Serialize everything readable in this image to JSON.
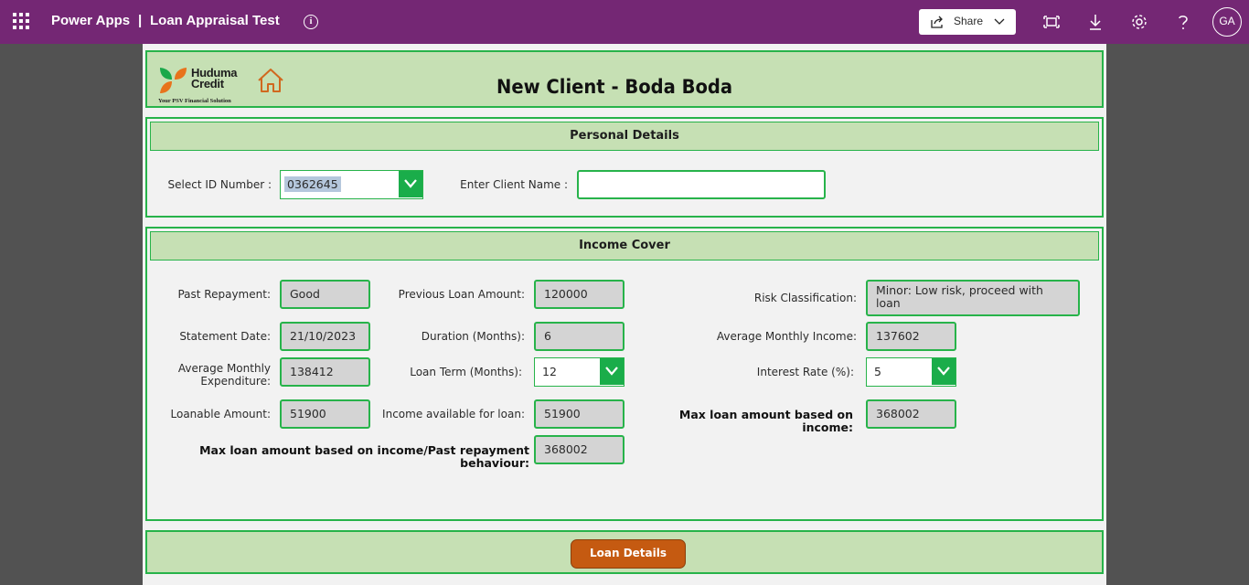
{
  "topbar": {
    "app_name": "Power Apps",
    "separator": "|",
    "app_title": "Loan Appraisal Test",
    "share_label": "Share",
    "avatar_initials": "GA",
    "icons": [
      "waffle-icon",
      "info-icon",
      "share-icon",
      "chevron-down-icon",
      "fit-screen-icon",
      "download-icon",
      "settings-icon",
      "help-icon"
    ]
  },
  "header": {
    "logo_line1": "Huduma",
    "logo_line2": "Credit",
    "logo_tagline": "Your PSV Financial Solution",
    "title": "New Client - Boda Boda"
  },
  "personal": {
    "section_title": "Personal Details",
    "id_label": "Select ID Number :",
    "id_value": "0362645",
    "name_label": "Enter Client Name :",
    "name_value": ""
  },
  "income": {
    "section_title": "Income Cover",
    "past_repayment_label": "Past Repayment:",
    "past_repayment_value": "Good",
    "prev_loan_label": "Previous Loan Amount:",
    "prev_loan_value": "120000",
    "risk_label": "Risk Classification:",
    "risk_value": "Minor: Low risk, proceed with loan",
    "statement_date_label": "Statement Date:",
    "statement_date_value": "21/10/2023",
    "duration_label": "Duration (Months):",
    "duration_value": "6",
    "avg_income_label": "Average Monthly Income:",
    "avg_income_value": "137602",
    "avg_exp_label_1": "Average Monthly",
    "avg_exp_label_2": "Expenditure:",
    "avg_exp_value": "138412",
    "loan_term_label": "Loan Term (Months):",
    "loan_term_value": "12",
    "interest_label": "Interest Rate (%):",
    "interest_value": "5",
    "loanable_label": "Loanable Amount:",
    "loanable_value": "51900",
    "income_avail_label": "Income available for loan:",
    "income_avail_value": "51900",
    "max_income_label": "Max loan amount based on income:",
    "max_income_value": "368002",
    "max_past_label": "Max loan amount based on income/Past repayment behaviour:",
    "max_past_value": "368002"
  },
  "footer": {
    "loan_details_label": "Loan Details"
  },
  "colors": {
    "topbar": "#742774",
    "panel_green": "#c6e0b4",
    "border_green": "#27b34a",
    "button_orange": "#c55a11"
  }
}
